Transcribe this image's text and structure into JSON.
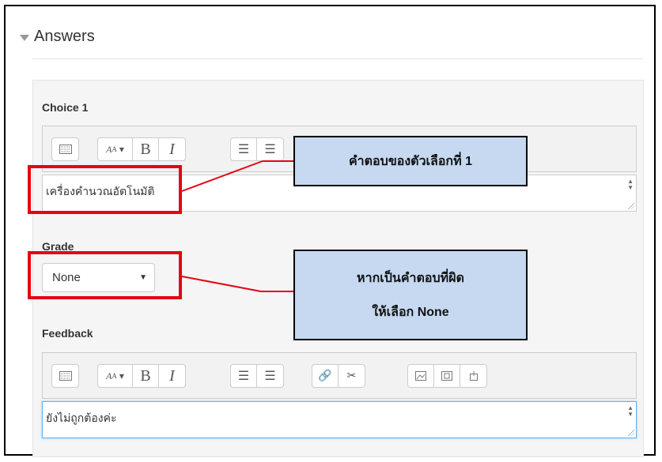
{
  "section": {
    "title": "Answers"
  },
  "choice": {
    "label": "Choice 1",
    "value": "เครื่องคำนวณอัตโนมัติ"
  },
  "grade": {
    "label": "Grade",
    "selected": "None"
  },
  "feedback": {
    "label": "Feedback",
    "value": "ยังไม่ถูกต้องค่ะ"
  },
  "editor": {
    "font_button": "Aₐ"
  },
  "annotations": {
    "callout_choice": "คำตอบของตัวเลือกที่ 1",
    "callout_grade_line1": "หากเป็นคำตอบที่ผิด",
    "callout_grade_line2": "ให้เลือก None"
  },
  "colors": {
    "highlight": "#e30613",
    "callout_fill": "#c6d9f1"
  }
}
